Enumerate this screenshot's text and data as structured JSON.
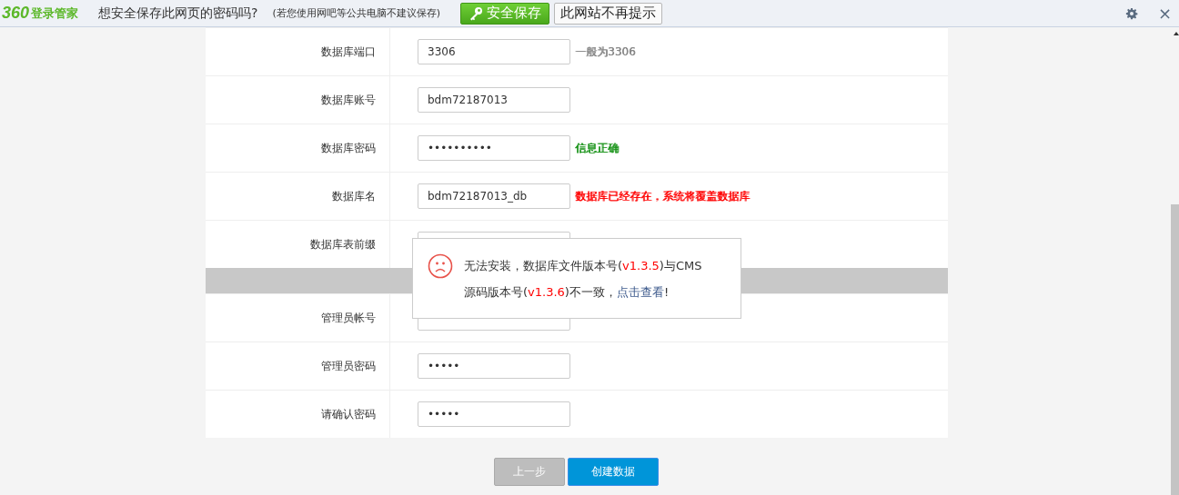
{
  "password_bar": {
    "logo_mark": "360",
    "logo_text": "登录管家",
    "question": "想安全保存此网页的密码吗?",
    "note": "(若您使用网吧等公共电脑不建议保存)",
    "save_button": "安全保存",
    "dismiss_button": "此网站不再提示",
    "close_glyph": "×"
  },
  "sections": [
    {
      "heading_visible": false,
      "fields": [
        {
          "label": "数据库端口",
          "value": "3306",
          "message": "一般为3306",
          "color": "#888888"
        },
        {
          "label": "数据库账号",
          "value": "bdm72187013"
        },
        {
          "label": "数据库密码",
          "value": "••••••••••",
          "message": "信息正确",
          "color": "#159115"
        },
        {
          "label": "数据库名",
          "value": "bdm72187013_db",
          "message": "数据库已经存在，系统将覆盖数据库",
          "color": "#ff0000"
        },
        {
          "label": "数据库表前缀"
        }
      ]
    },
    {
      "heading_visible": true,
      "fields": [
        {
          "label": "管理员帐号"
        },
        {
          "label": "管理员密码",
          "value": "•••••"
        },
        {
          "label": "请确认密码",
          "value": "•••••"
        }
      ]
    }
  ],
  "buttons": [
    {
      "label": "上一步",
      "disabled": true
    },
    {
      "label": "创建数据",
      "disabled": false
    }
  ],
  "dialog": {
    "segments": [
      {
        "text": "无法安装，数据库文件版本号(",
        "kind": "plain"
      },
      {
        "text": "v1.3.5",
        "kind": "version"
      },
      {
        "text": ")与CMS",
        "kind": "plain"
      },
      {
        "text": "源码版本号(",
        "kind": "plain",
        "new_line": true
      },
      {
        "text": "v1.3.6",
        "kind": "version"
      },
      {
        "text": ")不一致，",
        "kind": "plain"
      },
      {
        "text": "点击查看",
        "kind": "link"
      },
      {
        "text": "!",
        "kind": "plain"
      }
    ]
  }
}
